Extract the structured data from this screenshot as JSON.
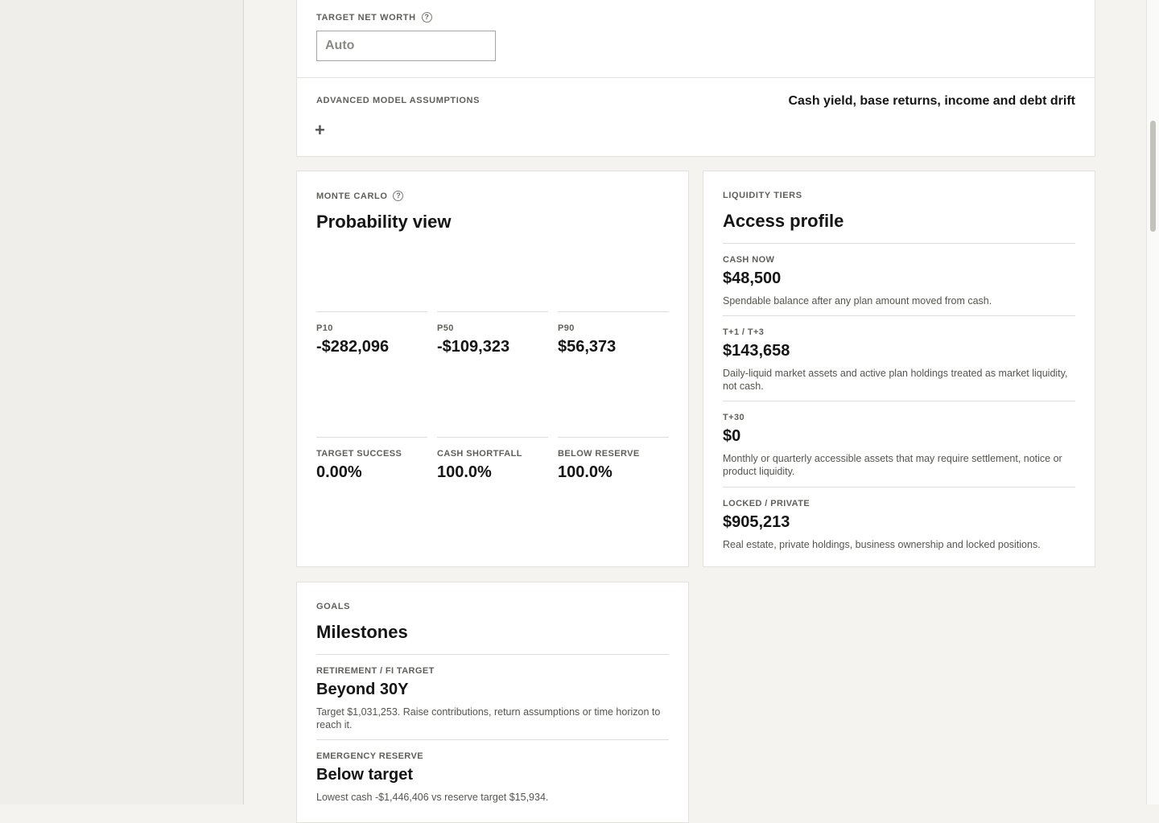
{
  "target_net_worth": {
    "label": "TARGET NET WORTH",
    "help_icon": "?",
    "placeholder": "Auto"
  },
  "assumptions": {
    "label": "ADVANCED MODEL ASSUMPTIONS",
    "summary": "Cash yield, base returns, income and debt drift",
    "expand_symbol": "+"
  },
  "monte_carlo": {
    "eyebrow": "MONTE CARLO",
    "help_icon": "?",
    "title": "Probability view",
    "percentiles": [
      {
        "label": "P10",
        "value": "-$282,096"
      },
      {
        "label": "P50",
        "value": "-$109,323"
      },
      {
        "label": "P90",
        "value": "$56,373"
      }
    ],
    "rates": [
      {
        "label": "TARGET SUCCESS",
        "value": "0.00%"
      },
      {
        "label": "CASH SHORTFALL",
        "value": "100.0%"
      },
      {
        "label": "BELOW RESERVE",
        "value": "100.0%"
      }
    ]
  },
  "liquidity": {
    "eyebrow": "LIQUIDITY TIERS",
    "title": "Access profile",
    "tiers": [
      {
        "label": "CASH NOW",
        "value": "$48,500",
        "desc": "Spendable balance after any plan amount moved from cash."
      },
      {
        "label": "T+1 / T+3",
        "value": "$143,658",
        "desc": "Daily-liquid market assets and active plan holdings treated as market liquidity, not cash."
      },
      {
        "label": "T+30",
        "value": "$0",
        "desc": "Monthly or quarterly accessible assets that may require settlement, notice or product liquidity."
      },
      {
        "label": "LOCKED / PRIVATE",
        "value": "$905,213",
        "desc": "Real estate, private holdings, business ownership and locked positions."
      }
    ]
  },
  "goals": {
    "eyebrow": "GOALS",
    "title": "Milestones",
    "items": [
      {
        "label": "RETIREMENT / FI TARGET",
        "value": "Beyond 30Y",
        "desc": "Target $1,031,253. Raise contributions, return assumptions or time horizon to reach it."
      },
      {
        "label": "EMERGENCY RESERVE",
        "value": "Below target",
        "desc": "Lowest cash -$1,446,406 vs reserve target $15,934."
      }
    ]
  }
}
